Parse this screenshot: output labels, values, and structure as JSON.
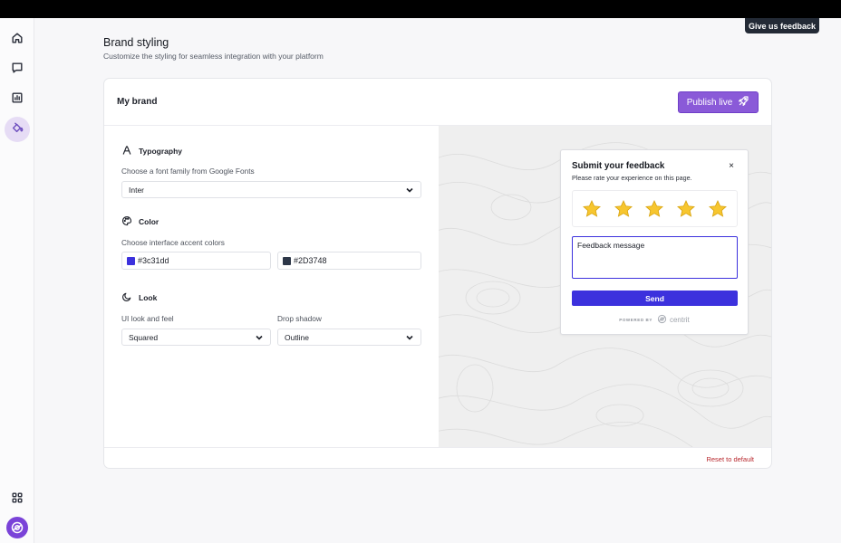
{
  "header": {
    "feedback_tab": "Give us feedback"
  },
  "sidebar": {
    "items": [
      {
        "icon": "home-icon"
      },
      {
        "icon": "chat-icon"
      },
      {
        "icon": "chart-icon"
      },
      {
        "icon": "paint-bucket-icon",
        "active": true
      },
      {
        "icon": "apps-grid-icon"
      }
    ],
    "logo": "centrit-logo-icon"
  },
  "page": {
    "title": "Brand styling",
    "subtitle": "Customize the styling for seamless integration with your platform"
  },
  "card": {
    "title": "My brand",
    "publish_label": "Publish live",
    "reset_label": "Reset to default"
  },
  "typography": {
    "heading": "Typography",
    "label": "Choose a font family from Google Fonts",
    "value": "Inter"
  },
  "color": {
    "heading": "Color",
    "label": "Choose interface accent colors",
    "primary": "#3c31dd",
    "secondary": "#2D3748"
  },
  "look": {
    "heading": "Look",
    "look_label": "UI look and feel",
    "look_value": "Squared",
    "shadow_label": "Drop shadow",
    "shadow_value": "Outline"
  },
  "widget": {
    "title": "Submit your feedback",
    "subtitle": "Please rate your experience on this page.",
    "close": "×",
    "rating_stars": 5,
    "message_value": "Feedback message",
    "send_label": "Send",
    "powered_by": "POWERED BY",
    "brand": "centrit"
  },
  "colors": {
    "accent_purple": "#8a5ad8",
    "widget_accent": "#3c31dd",
    "secondary_swatch": "#2D3748",
    "reset_red": "#b8282e"
  }
}
